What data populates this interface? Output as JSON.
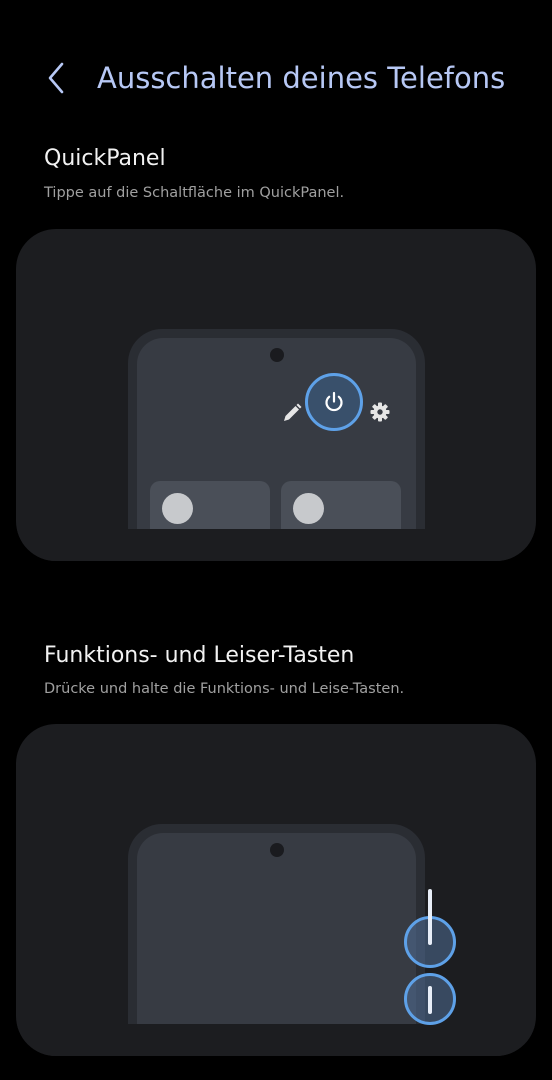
{
  "header": {
    "back_icon": "chevron-left-icon",
    "title": "Ausschalten deines Telefons"
  },
  "sections": [
    {
      "title": "QuickPanel",
      "description": "Tippe auf die Schaltfläche im QuickPanel.",
      "illustration": {
        "icons": [
          "pencil-icon",
          "power-icon",
          "gear-icon"
        ],
        "highlighted": "power-icon"
      }
    },
    {
      "title": "Funktions- und Leiser-Tasten",
      "description": "Drücke und halte die Funktions- und Leise-Tasten.",
      "illustration": {
        "highlighted": [
          "side-key",
          "volume-down-key"
        ]
      }
    }
  ],
  "colors": {
    "background": "#000000",
    "card": "#1c1d20",
    "title": "#b7c8f5",
    "accent": "#5ea1e8"
  }
}
